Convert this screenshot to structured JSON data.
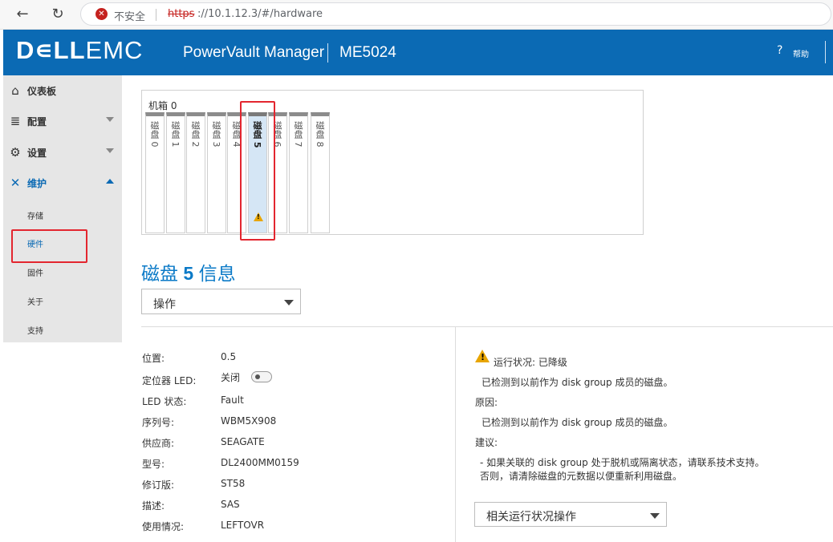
{
  "browser": {
    "back_icon": "arrow-left",
    "refresh_icon": "refresh",
    "security_label": "不安全",
    "url_protocol": "https",
    "url_rest": "://10.1.12.3/#/hardware"
  },
  "header": {
    "logo_dell": "D∊LL",
    "logo_emc": "EMC",
    "product": "PowerVault Manager",
    "model": "ME5024",
    "help_icon": "?",
    "help_label": "帮助",
    "background_color": "#0b6ab4"
  },
  "sidebar": {
    "items": [
      {
        "label": "仪表板",
        "icon": "home-icon"
      },
      {
        "label": "配置",
        "icon": "database-icon"
      },
      {
        "label": "设置",
        "icon": "gear-icon"
      },
      {
        "label": "维护",
        "icon": "wrench-icon"
      }
    ],
    "sub_items": [
      "存储",
      "硬件",
      "固件",
      "关于",
      "支持"
    ],
    "active_sub": "硬件"
  },
  "enclosure": {
    "title": "机箱 0",
    "slots": [
      "磁盘 0",
      "磁盘 1",
      "磁盘 2",
      "磁盘 3",
      "磁盘 4",
      "磁盘 5",
      "磁盘 6",
      "磁盘 7",
      "磁盘 8"
    ],
    "selected_slot": "磁盘 5"
  },
  "disk_info": {
    "title_prefix": "磁盘",
    "title_number": "5",
    "title_suffix": "信息",
    "action_label": "操作",
    "properties": [
      {
        "label": "位置:",
        "value": "0.5"
      },
      {
        "label": "定位器 LED:",
        "value": "关闭"
      },
      {
        "label": "LED 状态:",
        "value": "Fault"
      },
      {
        "label": "序列号:",
        "value": "WBM5X908"
      },
      {
        "label": "供应商:",
        "value": "SEAGATE"
      },
      {
        "label": "型号:",
        "value": "DL2400MM0159"
      },
      {
        "label": "修订版:",
        "value": "ST58"
      },
      {
        "label": "描述:",
        "value": "SAS"
      },
      {
        "label": "使用情况:",
        "value": "LEFTOVR"
      }
    ]
  },
  "health": {
    "status": "运行状况: 已降级",
    "detail": "已检测到以前作为 disk group 成员的磁盘。",
    "reason_label": "原因:",
    "reason": "已检测到以前作为 disk group 成员的磁盘。",
    "recommendation_label": "建议:",
    "recommendation_line1": "- 如果关联的 disk group 处于脱机或隔离状态，请联系技术支持。",
    "recommendation_line2": "否则，请清除磁盘的元数据以便重新利用磁盘。",
    "action_label": "相关运行状况操作"
  }
}
